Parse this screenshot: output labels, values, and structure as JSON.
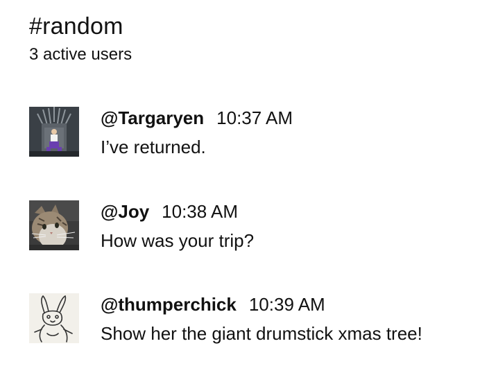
{
  "channel": {
    "name": "#random",
    "active_users": "3 active users"
  },
  "messages": [
    {
      "username": "@Targaryen",
      "time": "10:37 AM",
      "text": "I’ve returned.",
      "avatar_icon": "iron-throne-avatar"
    },
    {
      "username": "@Joy",
      "time": "10:38 AM",
      "text": "How was your trip?",
      "avatar_icon": "tabby-cat-avatar"
    },
    {
      "username": "@thumperchick",
      "time": "10:39 AM",
      "text": "Show her the giant drumstick xmas tree!",
      "avatar_icon": "rabbit-sketch-avatar"
    }
  ]
}
